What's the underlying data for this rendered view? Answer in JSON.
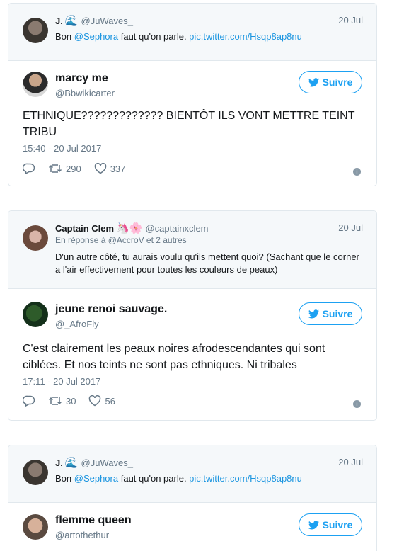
{
  "tweets": [
    {
      "quote": {
        "name": "J.",
        "name_emoji": "🌊",
        "handle": "@JuWaves_",
        "date": "20 Jul",
        "reply_to": "",
        "text_pre": "Bon ",
        "text_mention": "@Sephora",
        "text_mid": " faut qu'on parle. ",
        "text_link": "pic.twitter.com/Hsqp8ap8nu"
      },
      "author": {
        "name": "marcy me",
        "handle": "@Bbwikicarter"
      },
      "follow_label": "Suivre",
      "text": "ETHNIQUE????????????? BIENTÔT ILS VONT METTRE TEINT TRIBU",
      "time": "15:40 - 20 Jul 2017",
      "retweets": "290",
      "likes": "337"
    },
    {
      "quote": {
        "name": "Captain Clem",
        "name_emoji": "🦄🌸",
        "handle": "@captainxclem",
        "date": "20 Jul",
        "reply_to": "En réponse à @AccroV et 2 autres",
        "text": "D'un autre côté, tu aurais voulu qu'ils mettent quoi? (Sachant que le corner a l'air effectivement pour toutes les couleurs de peaux)"
      },
      "author": {
        "name": "jeune renoi sauvage.",
        "handle": "@_AfroFly"
      },
      "follow_label": "Suivre",
      "text": "C'est clairement les peaux noires afrodescendantes qui sont ciblées. Et nos teints ne sont pas ethniques. Ni tribales",
      "time": "17:11 - 20 Jul 2017",
      "retweets": "30",
      "likes": "56"
    },
    {
      "quote": {
        "name": "J.",
        "name_emoji": "🌊",
        "handle": "@JuWaves_",
        "date": "20 Jul",
        "reply_to": "",
        "text_pre": "Bon ",
        "text_mention": "@Sephora",
        "text_mid": " faut qu'on parle. ",
        "text_link": "pic.twitter.com/Hsqp8ap8nu"
      },
      "author": {
        "name": "flemme queen",
        "handle": "@artothethur"
      },
      "follow_label": "Suivre"
    }
  ],
  "colors": {
    "accent": "#1da1f2",
    "muted": "#657786",
    "quote_bg": "#f5f8fa",
    "border": "#e1e8ed"
  },
  "icons": [
    "twitter-bird-icon",
    "reply-icon",
    "retweet-icon",
    "heart-icon",
    "info-icon"
  ]
}
